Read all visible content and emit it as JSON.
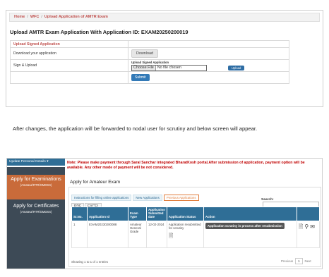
{
  "top_screen": {
    "breadcrumb": [
      "Home",
      "WFC",
      "Upload Application of AMTR Exam"
    ],
    "heading": "Upload AMTR Exam Application With Application ID: EXAM20250200019",
    "table_header": "Upload Signed Application",
    "row_download_label": "Download your application",
    "download_button": "Download",
    "row_sign_label": "Sign & Upload",
    "upload_field_label": "Upload Signed Application",
    "choose_file": "Choose File",
    "no_file": "No file chosen",
    "upload_button": "Upload",
    "submit_button": "Submit"
  },
  "paragraph": "After changes, the application will be forwarded to nodal user for scrutiny and below screen will appear.",
  "bottom_screen": {
    "update_details": "Update Personal Details",
    "sidebar": [
      {
        "title": "Apply for Examinations",
        "sub": "(Amateur/RTR/GMDSS)"
      },
      {
        "title": "Apply for Certificates",
        "sub": "(Amateur/RTR/GMDSS)"
      }
    ],
    "note": "Note: Please make payment through Saral Sanchar integrated BharatKosh portal.After submission of application, payment option will be available. Any other mode of payment will be not considered.",
    "page_title": "Apply for Amateur Exam",
    "tabs": [
      "Instructions for filling online applications",
      "New Applications",
      "Previous Applications"
    ],
    "export_buttons": [
      "PDF",
      "EXCEL"
    ],
    "search_label": "Search:",
    "columns": [
      "Sr.No.",
      "Application Id",
      "Exam Type",
      "Application Submitted date",
      "Application Status",
      "Action"
    ],
    "rows": [
      {
        "sr": "1",
        "app_id": "EXAM20230200088",
        "exam_type": "Amateur General Grade",
        "date": "12-02-2024",
        "status": "Application resubmitted for scrutiny",
        "action": "Application scrutiny in process after resubmission"
      }
    ],
    "showing": "Showing 1 to 1 of 1 entries",
    "pager": {
      "prev": "Previous",
      "page": "1",
      "next": "Next"
    }
  }
}
